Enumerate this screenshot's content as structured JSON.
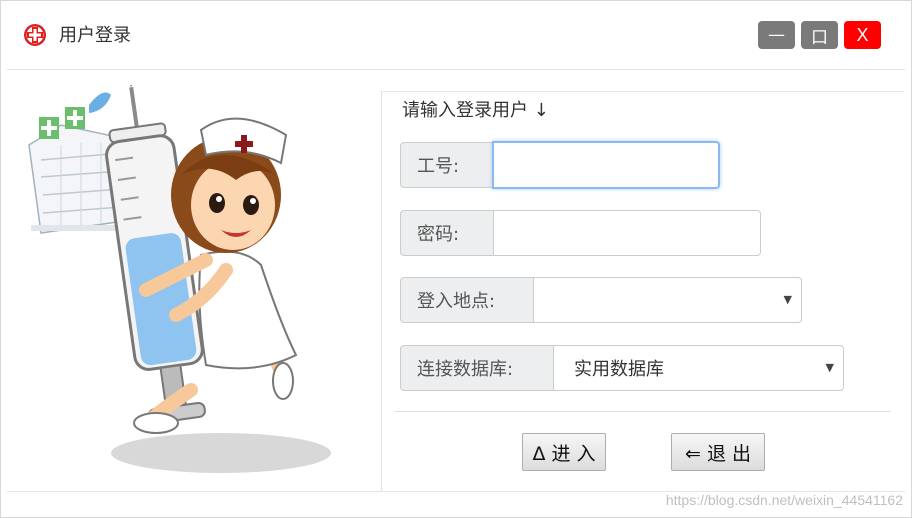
{
  "window": {
    "title": "用户登录",
    "buttons": {
      "minimize": "—",
      "maximize": "口",
      "close": "X"
    }
  },
  "icons": {
    "app": "red-cross-icon"
  },
  "colors": {
    "close": "#ff0000",
    "window_button": "#7a7a7a",
    "focus": "#8ab8ef"
  },
  "form": {
    "prompt": "请输入登录用户 ↓",
    "employee_id": {
      "label": "工号:",
      "value": ""
    },
    "password": {
      "label": "密码:",
      "value": ""
    },
    "location": {
      "label": "登入地点:",
      "value": ""
    },
    "database": {
      "label": "连接数据库:",
      "value": "实用数据库"
    }
  },
  "actions": {
    "enter": "Δ 进 入",
    "exit": "⇐ 退  出"
  },
  "watermark": "https://blog.csdn.net/weixin_44541162"
}
